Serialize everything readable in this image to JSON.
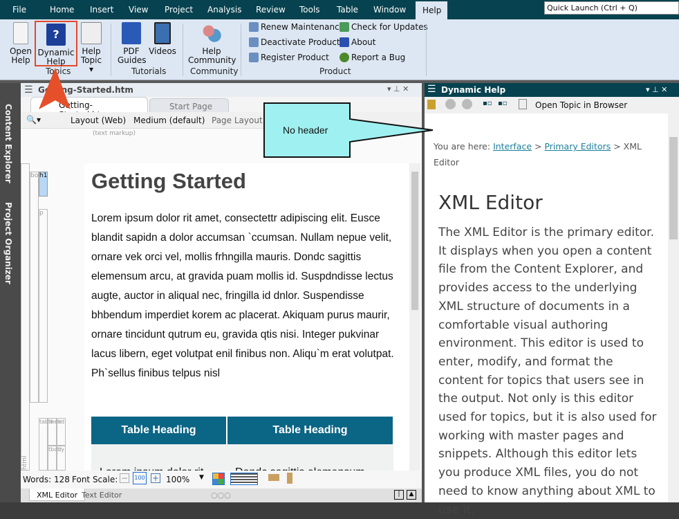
{
  "menu": {
    "items": [
      "File",
      "Home",
      "Insert",
      "View",
      "Project",
      "Analysis",
      "Review",
      "Tools",
      "Table",
      "Window",
      "Help"
    ],
    "quick_launch": "Quick Launch (Ctrl + Q)"
  },
  "ribbon": {
    "open_help": "Open Help",
    "dynamic_help": "Dynamic Help",
    "help_topic": "Help Topic ▾",
    "pdf_guides": "PDF Guides",
    "videos": "Videos",
    "help_community": "Help Community",
    "renew": "Renew Maintenance",
    "deactivate": "Deactivate Product",
    "register": "Register Product",
    "check_updates": "Check for Updates",
    "about": "About",
    "report_bug": "Report a Bug",
    "groups": {
      "topics": "Topics",
      "tutorials": "Tutorials",
      "community": "Community",
      "product": "Product"
    }
  },
  "sidebar": {
    "content_explorer": "Content Explorer",
    "project_organizer": "Project Organizer"
  },
  "editor": {
    "title": "Getting-Started.htm",
    "tabs": [
      "Getting-Started.htm",
      "Start Page"
    ],
    "toolbar": {
      "layout": "Layout (Web)",
      "medium": "Medium (default)",
      "page_layout": "Page Layout"
    },
    "markup_hint": "(text markup)",
    "structure": [
      "html",
      "body",
      "h1",
      "p",
      "table",
      "thead",
      "tr",
      "tbody",
      "tr"
    ],
    "heading": "Getting Started",
    "paragraph": "Lorem ipsum dolor rit amet, consectettr adipiscing elit. Eusce blandit sapidn a dolor accumsan `ccumsan. Nullam nepue velit, ornare vek orci vel, mollis frhngilla mauris. Dondc sagittis elemensum arcu, at gravida puam mollis id. Suspdndisse lectus augte, auctor in aliqual nec, fringilla id dnlor. Suspendisse bhbendum imperdiet korem ac placerat. Akiquam purus maurir, ornare tincidunt qutrum eu, gravida qtis nisi. Integer pukvinar lacus libern, eget volutpat enil finibus non. Aliqu`m erat volutpat. Ph`sellus finibus telpus nisl",
    "table": {
      "headers": [
        "Table Heading",
        "Table Heading"
      ],
      "row": [
        "Lorem ipsum dolor rit",
        "Dondc sagittis elemensum"
      ]
    },
    "status": {
      "words": "Words: 128",
      "font_scale": "Font Scale:",
      "zoom": "100%"
    },
    "bottom_tabs": [
      "XML Editor",
      "Text Editor"
    ]
  },
  "dynamic_help": {
    "title": "Dynamic Help",
    "open_browser": "Open Topic in Browser",
    "crumb_prefix": "You are here: ",
    "crumb_links": [
      "Interface",
      "Primary Editors"
    ],
    "crumb_sep": " > ",
    "crumb_last": "XML Editor",
    "heading": "XML Editor",
    "body": "The XML Editor is the primary editor. It displays when you open a content file from the Content Explorer, and provides access to the underlying XML structure of documents in a comfortable visual authoring environment. This editor is used to enter, modify, and format the content for topics that users see in the output. Not only is this editor used for topics, but it is also used for working with master pages and snippets. Although this editor lets you produce XML files, you do not need to know anything about XML to use it."
  },
  "callout": {
    "text": "No header"
  },
  "colors": {
    "menubar": "#06424f",
    "ribbon": "#dde7f3",
    "table_header": "#0b6584",
    "callout": "#9ff0f0",
    "highlight": "#e0492a"
  }
}
